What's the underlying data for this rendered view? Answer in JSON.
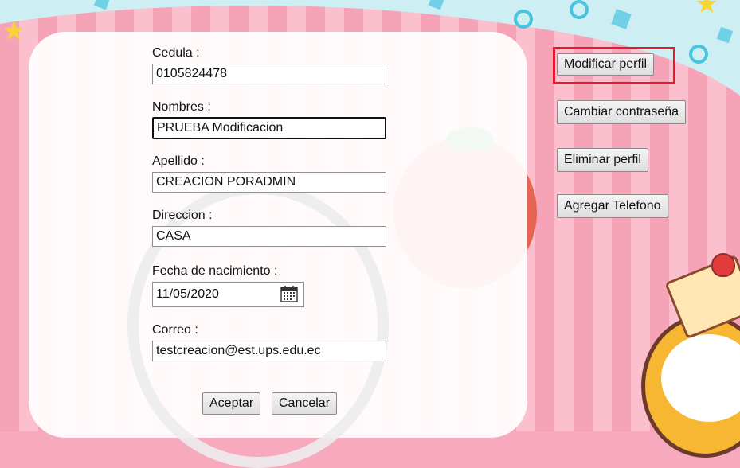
{
  "form": {
    "fields": [
      {
        "label": "Cedula :",
        "value": "0105824478"
      },
      {
        "label": "Nombres :",
        "value": "PRUEBA Modificacion"
      },
      {
        "label": "Apellido :",
        "value": "CREACION PORADMIN"
      },
      {
        "label": "Direccion :",
        "value": "CASA"
      },
      {
        "label": "Fecha de nacimiento :",
        "value": "11/05/2020"
      },
      {
        "label": "Correo :",
        "value": "testcreacion@est.ups.edu.ec"
      }
    ],
    "accept_label": "Aceptar",
    "cancel_label": "Cancelar"
  },
  "side_menu": {
    "items": [
      {
        "label": "Modificar perfil",
        "highlighted": true
      },
      {
        "label": "Cambiar contraseña"
      },
      {
        "label": "Eliminar perfil"
      },
      {
        "label": "Agregar Telefono"
      }
    ]
  },
  "icons": {
    "calendar": "calendar-icon"
  },
  "colors": {
    "highlight_border": "#e8192c",
    "background_pink": "#f6a3b8",
    "sky": "#cdeff4"
  }
}
